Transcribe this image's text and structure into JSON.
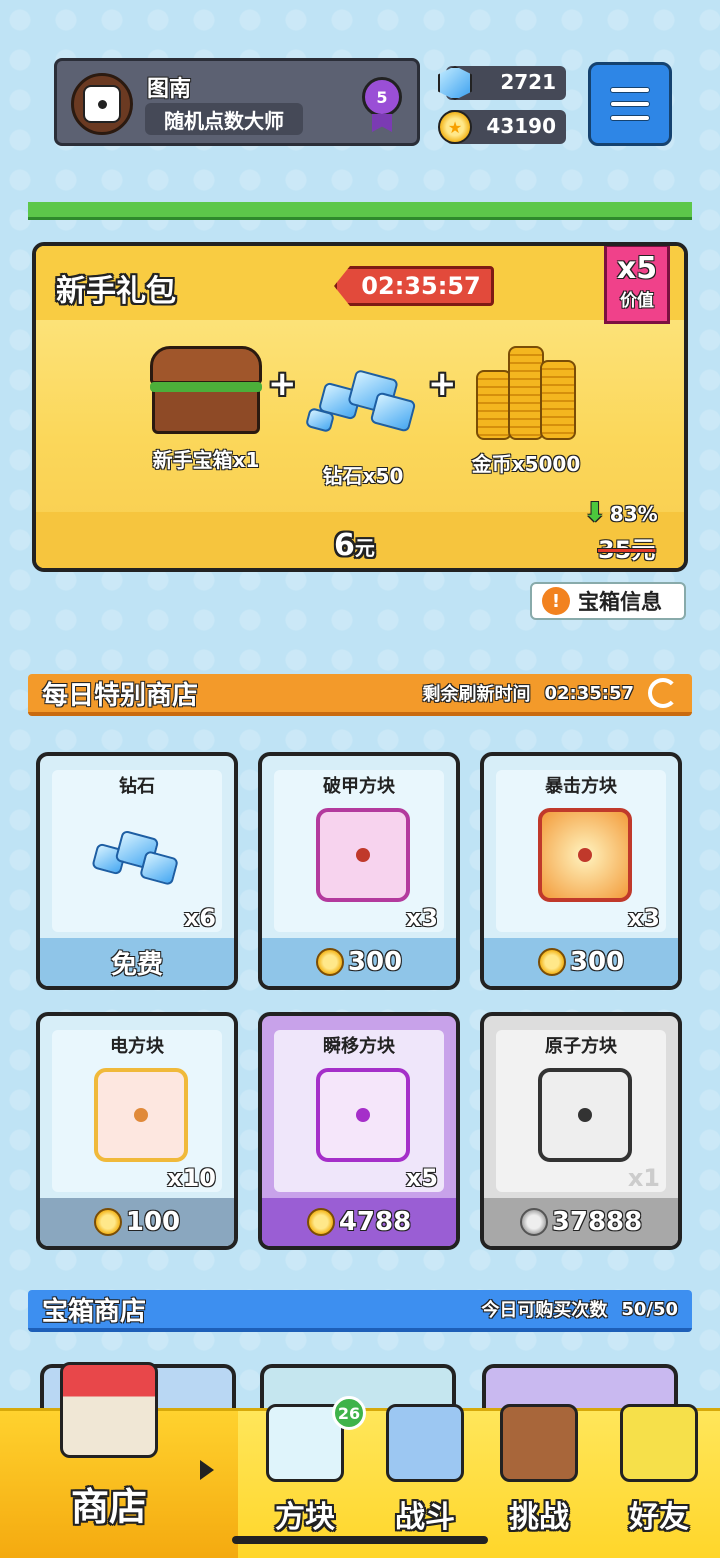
{
  "profile": {
    "name": "图南",
    "title": "随机点数大师",
    "rank": "5"
  },
  "resources": {
    "gems": "2721",
    "coins": "43190"
  },
  "starter_pack": {
    "title": "新手礼包",
    "timer": "02:35:57",
    "value_multiplier": "x5",
    "value_label": "价值",
    "items": [
      {
        "label": "新手宝箱x1",
        "icon": "chest-icon"
      },
      {
        "label": "钻石x50",
        "icon": "gems-icon"
      },
      {
        "label": "金币x5000",
        "icon": "coins-icon"
      }
    ],
    "price": "6",
    "price_unit": "元",
    "discount": "83%",
    "old_price": "35元"
  },
  "chest_info_button": "宝箱信息",
  "daily_shop": {
    "title": "每日特别商店",
    "refresh_label": "剩余刷新时间",
    "refresh_timer": "02:35:57",
    "items": [
      {
        "name": "钻石",
        "qty": "x6",
        "price": "免费"
      },
      {
        "name": "破甲方块",
        "qty": "x3",
        "price": "300"
      },
      {
        "name": "暴击方块",
        "qty": "x3",
        "price": "300"
      },
      {
        "name": "电方块",
        "qty": "x10",
        "price": "100"
      },
      {
        "name": "瞬移方块",
        "qty": "x5",
        "price": "4788"
      },
      {
        "name": "原子方块",
        "qty": "x1",
        "price": "37888"
      }
    ]
  },
  "chest_shop": {
    "title": "宝箱商店",
    "purchases_label": "今日可购买次数",
    "purchases_value": "50/50"
  },
  "nav": {
    "shop": "商店",
    "blocks": "方块",
    "blocks_badge": "26",
    "battle": "战斗",
    "challenge": "挑战",
    "friends": "好友"
  },
  "colors": {
    "daily_header": "#f39a2a",
    "chest_header": "#3d8ff0",
    "nav_bg": "#ffd62a"
  }
}
